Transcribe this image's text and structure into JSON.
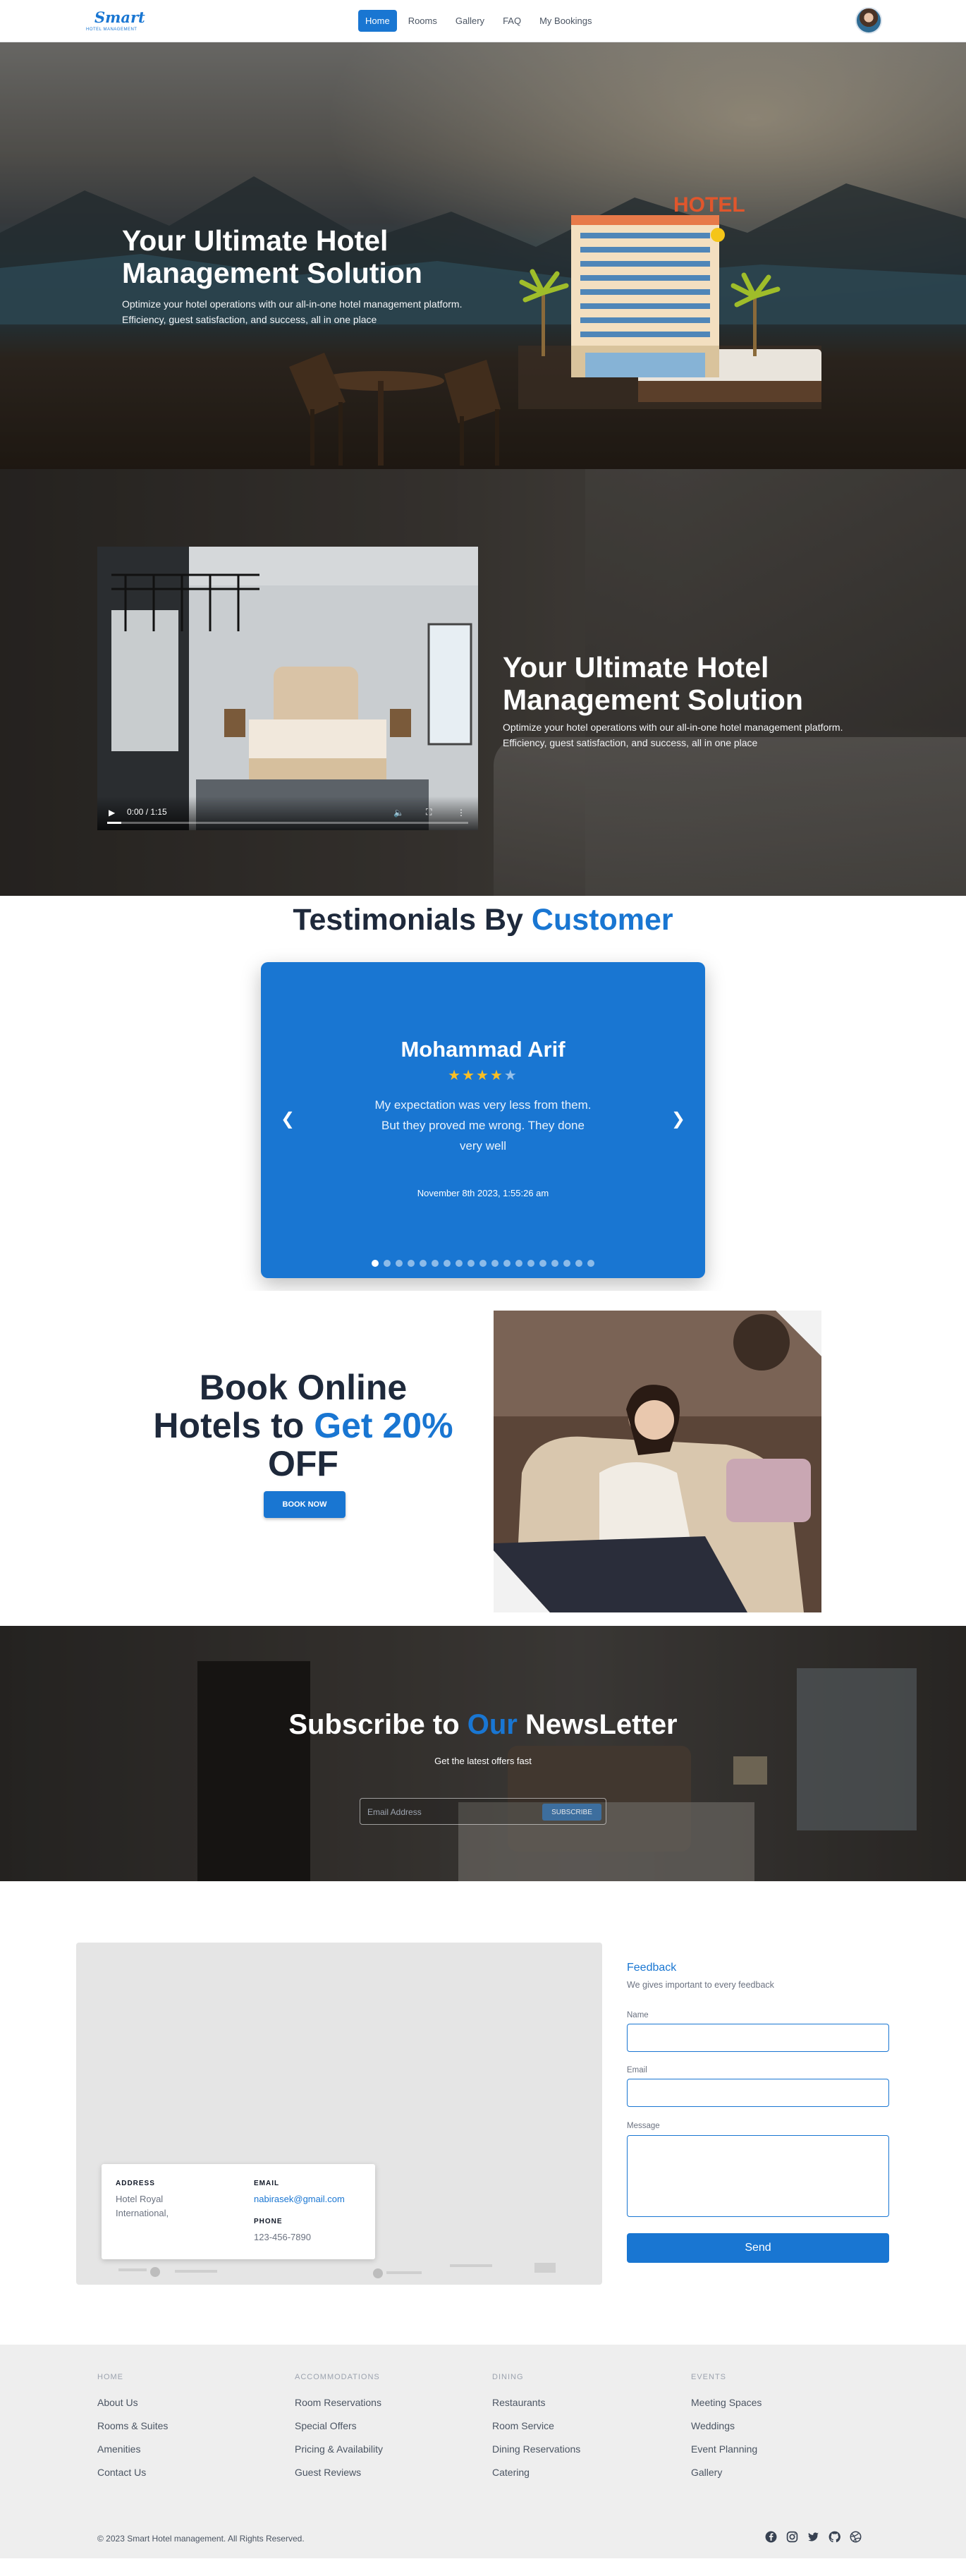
{
  "brand": {
    "logo_word": "Smart",
    "logo_sub": "HOTEL MANAGEMENT"
  },
  "nav": {
    "items": [
      {
        "label": "Home",
        "active": true
      },
      {
        "label": "Rooms",
        "active": false
      },
      {
        "label": "Gallery",
        "active": false
      },
      {
        "label": "FAQ",
        "active": false
      },
      {
        "label": "My Bookings",
        "active": false
      }
    ],
    "avatar_icon": "user-avatar"
  },
  "hero": {
    "title_line1": "Your Ultimate Hotel",
    "title_line2": "Management Solution",
    "text_line1": "Optimize your hotel operations with our all-in-one hotel management platform.",
    "text_line2": "Efficiency, guest satisfaction, and success, all in one place",
    "building_sign": "HOTEL"
  },
  "video_section": {
    "title_line1": "Your Ultimate Hotel",
    "title_line2": "Management Solution",
    "text_line1": "Optimize your hotel operations with our all-in-one hotel management platform.",
    "text_line2": "Efficiency, guest satisfaction, and success, all in one place",
    "player": {
      "time": "0:00 / 1:15",
      "progress": 0.04
    }
  },
  "testimonials": {
    "heading_main": "Testimonials By",
    "heading_accent": "Customer",
    "name": "Mohammad Arif",
    "rating": 4,
    "rating_max": 5,
    "quote": "My expectation was very less from them. But they proved me wrong. They done very well",
    "date": "November 8th 2023, 1:55:26 am",
    "slide_count": 19,
    "active_slide": 0
  },
  "book": {
    "line1": "Book Online",
    "line2_main": "Hotels to",
    "line2_accent": "Get 20%",
    "line3": "OFF",
    "button": "BOOK NOW"
  },
  "newsletter": {
    "title_start": "Subscribe to",
    "title_accent": "Our",
    "title_end": "NewsLetter",
    "subtitle": "Get the latest offers fast",
    "placeholder": "Email Address",
    "button": "SUBSCRIBE"
  },
  "contact": {
    "address_label": "ADDRESS",
    "address_value": "Hotel Royal International,",
    "email_label": "EMAIL",
    "email_value": "nabirasek@gmail.com",
    "phone_label": "PHONE",
    "phone_value": "123-456-7890"
  },
  "feedback": {
    "title": "Feedback",
    "subtitle": "We gives important to every feedback",
    "name_label": "Name",
    "email_label": "Email",
    "message_label": "Message",
    "send": "Send"
  },
  "footer": {
    "columns": [
      {
        "heading": "HOME",
        "links": [
          "About Us",
          "Rooms & Suites",
          "Amenities",
          "Contact Us"
        ]
      },
      {
        "heading": "ACCOMMODATIONS",
        "links": [
          "Room Reservations",
          "Special Offers",
          "Pricing & Availability",
          "Guest Reviews"
        ]
      },
      {
        "heading": "DINING",
        "links": [
          "Restaurants",
          "Room Service",
          "Dining Reservations",
          "Catering"
        ]
      },
      {
        "heading": "EVENTS",
        "links": [
          "Meeting Spaces",
          "Weddings",
          "Event Planning",
          "Gallery"
        ]
      }
    ],
    "copyright": "© 2023 Smart Hotel management. All Rights Reserved.",
    "social_icons": [
      "facebook-icon",
      "instagram-icon",
      "twitter-icon",
      "github-icon",
      "dribbble-icon"
    ]
  },
  "colors": {
    "accent": "#1976d2",
    "star": "#fbbf24",
    "dark_text": "#1e293b",
    "footer_bg": "#eeeeee"
  }
}
